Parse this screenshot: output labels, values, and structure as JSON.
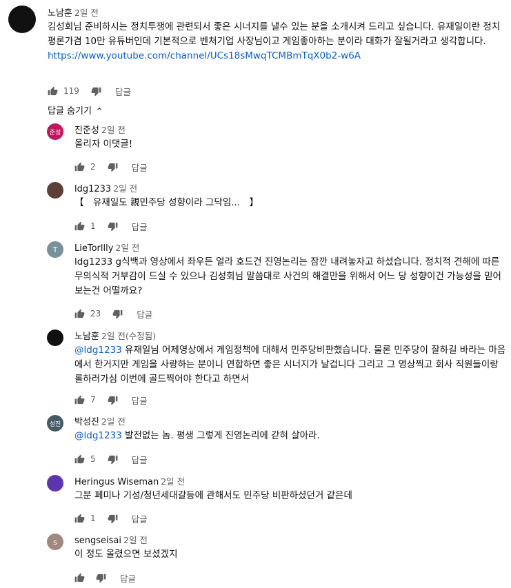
{
  "top": {
    "author": "노남훈",
    "time": "2일 전",
    "text": "김성회님 준비하시는 정치투쟁에 관련되서 좋은 시너지를 낼수 있는 분을 소개시켜 드리고 싶습니다. 유재일이란 정치평론가겸 10만 유튜버인데 기본적으로 벤처기업 사장님이고 게임좋아하는 분이라 대화가 잘될거라고 생각합니다.",
    "link": "https://www.youtube.com/channel/UCs18sMwqTCMBmTqX0b2-w6A",
    "likes": "119",
    "reply_label": "답글"
  },
  "hide_replies_label": "답글 숨기기",
  "replies": [
    {
      "author": "진준성",
      "time": "2일 전",
      "avatar_text": "준성",
      "avatar_color": "#c2185b",
      "mention": "",
      "text": "올리자 이댓글!",
      "likes": "2",
      "reply_label": "답글"
    },
    {
      "author": "ldg1233",
      "time": "2일 전",
      "avatar_text": "",
      "avatar_color": "#5d4037",
      "mention": "",
      "text": "【　유재일도 親민주당 성향이라 그닥임...　】",
      "likes": "1",
      "reply_label": "답글"
    },
    {
      "author": "LieTorllly",
      "time": "2일 전",
      "avatar_text": "T",
      "avatar_color": "#78909c",
      "mention": "",
      "text": "ldg1233 g식백과 영상에서 좌우든 얼라 호드건 진영논리는 잠깐 내려놓자고 하셨습니다. 정치적 견해에 따른 무의식적 거부감이 드실 수 있으나 김성회님 말씀대로 사건의 해결만을 위해서 어느 당 성향이건 가능성을 믿어보는건 어떨까요?",
      "likes": "23",
      "reply_label": "답글"
    },
    {
      "author": "노남훈",
      "time": "2일 전(수정됨)",
      "avatar_text": "",
      "avatar_color": "#111111",
      "mention": "@ldg1233",
      "text": " 유재일님 어제영상에서 게임정책에 대해서 민주당비판했습니다. 물론 민주당이 잘하길 바라는 마음에서 한거지만 게임을 사랑하는 분이니 연합하면 좋은 시너지가 날겁니다 그리고 그 영상찍고 회사 직원들이랑 롤하러가심 이번에 골드찍어야 한다고 하면서",
      "likes": "7",
      "reply_label": "답글"
    },
    {
      "author": "박성진",
      "time": "2일 전",
      "avatar_text": "성진",
      "avatar_color": "#455a64",
      "mention": "@ldg1233",
      "text": " 발전없는 놈. 평생 그렇게 진영논리에 갇혀 살아라.",
      "likes": "5",
      "reply_label": "답글"
    },
    {
      "author": "Heringus Wiseman",
      "time": "2일 전",
      "avatar_text": "",
      "avatar_color": "#5e35b1",
      "mention": "",
      "text": "그분 페미나 기성/청년세대갈등에 관해서도 민주당 비판하셨던거 같은데",
      "likes": "1",
      "reply_label": "답글"
    },
    {
      "author": "sengseisai",
      "time": "2일 전",
      "avatar_text": "s",
      "avatar_color": "#a1887f",
      "mention": "",
      "text": "이 정도 올렸으면 보셨겠지",
      "likes": "",
      "reply_label": "답글"
    }
  ]
}
